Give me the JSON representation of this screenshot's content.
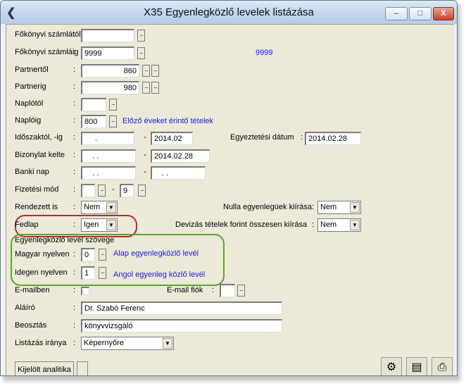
{
  "window": {
    "title": "X35 Egyenlegközlő levelek listázása",
    "min_label": "–",
    "max_label": "□",
    "close_label": "X"
  },
  "colon": ":",
  "dash": "-",
  "ellipsis": "...",
  "dropdown_arrow": "▼",
  "fields": {
    "fokszamlatol": {
      "label": "Főkönyvi számlától",
      "value": ""
    },
    "fokszamlaig": {
      "label": "Főkönyvi számláig",
      "value": "9999",
      "display": "9999"
    },
    "partnertol": {
      "label": "Partnertől",
      "value": "860"
    },
    "partnerig": {
      "label": "Partnerig",
      "value": "980"
    },
    "naplotol": {
      "label": "Naplótól",
      "value": ""
    },
    "naploig": {
      "label": "Naplóig",
      "value": "800",
      "link": "Előző éveket érintő tételek"
    },
    "idoszak": {
      "label": "Időszaktól, -ig",
      "from": ".",
      "to": "2014.02"
    },
    "egyeztetesi_datum": {
      "label": "Egyeztetési dátum",
      "value": "2014.02.28"
    },
    "bizonylat_kelte": {
      "label": "Bizonylat kelte",
      "from": ". .",
      "to": "2014.02.28"
    },
    "banki_nap": {
      "label": "Banki nap",
      "from": ". .",
      "to": ". ."
    },
    "fizetesi_mod": {
      "label": "Fizetési mód",
      "from": "",
      "to": "9"
    },
    "rendezett_is": {
      "label": "Rendezett is",
      "value": "Nem"
    },
    "nulla_egyenleguek": {
      "label": "Nulla egyenlegüek kiírása",
      "value": "Nem"
    },
    "fedlap": {
      "label": "Fedlap",
      "value": "Igen"
    },
    "devizas": {
      "label": "Devizás tételek forint összesen  kiírása",
      "value": "Nem"
    },
    "szoveg_group": {
      "label": "Egyenlegközlő levél szövege"
    },
    "magyar": {
      "label": "Magyar nyelven",
      "value": "0",
      "link": "Alap egyenlegközlő levél"
    },
    "idegen": {
      "label": "Idegen nyelven",
      "value": "1",
      "link": "Angol egyenleg közlő levél"
    },
    "emailben": {
      "label": "E-mailben"
    },
    "email_fiok": {
      "label": "E-mail fiók",
      "value": ""
    },
    "alairo": {
      "label": "Aláíró",
      "value": "Dr. Szabó Ferenc"
    },
    "beosztas": {
      "label": "Beosztás",
      "value": "könyvvizsgáló"
    },
    "listazas_iranya": {
      "label": "Listázás iránya",
      "value": "Képernyőre"
    }
  },
  "bottom": {
    "kijelolt_analitika_label": "Kijelölt analitika",
    "tool_icons": [
      "run-icon",
      "keyboard-icon",
      "print-icon"
    ]
  },
  "colors": {
    "red_highlight": "#c0262a",
    "green_highlight": "#5ba335",
    "link_blue": "#1a1adc"
  }
}
